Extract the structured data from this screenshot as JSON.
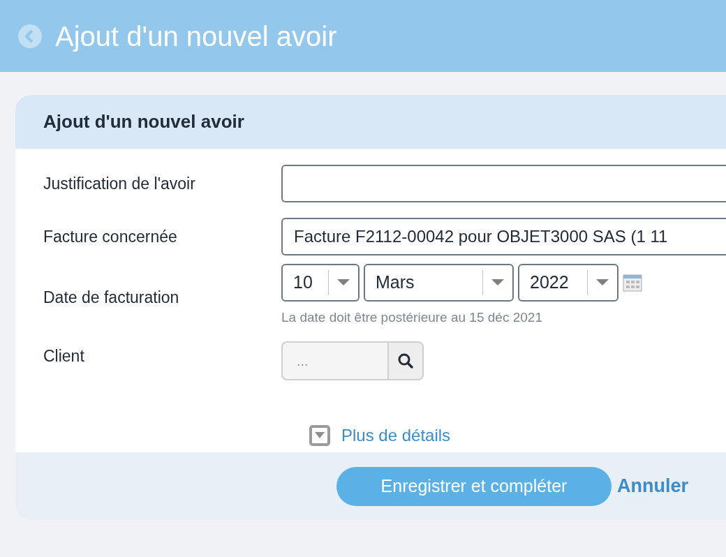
{
  "header": {
    "title": "Ajout d'un nouvel avoir"
  },
  "card": {
    "title": "Ajout d'un nouvel avoir"
  },
  "fields": [
    {
      "kind": "text",
      "label": "Justification de l'avoir"
    },
    {
      "kind": "select",
      "label": "Facture concernée",
      "value": "Facture F2112-00042 pour OBJET3000 SAS (1 11"
    },
    {
      "kind": "date",
      "label": "Date de facturation",
      "day": "10",
      "month": "Mars",
      "year": "2022",
      "hint": "La date doit être postérieure au 15 déc 2021"
    },
    {
      "kind": "lookup",
      "label": "Client",
      "placeholder": "..."
    }
  ],
  "more_link": "Plus de détails",
  "buttons": {
    "save": "Enregistrer et compléter",
    "cancel": "Annuler"
  }
}
